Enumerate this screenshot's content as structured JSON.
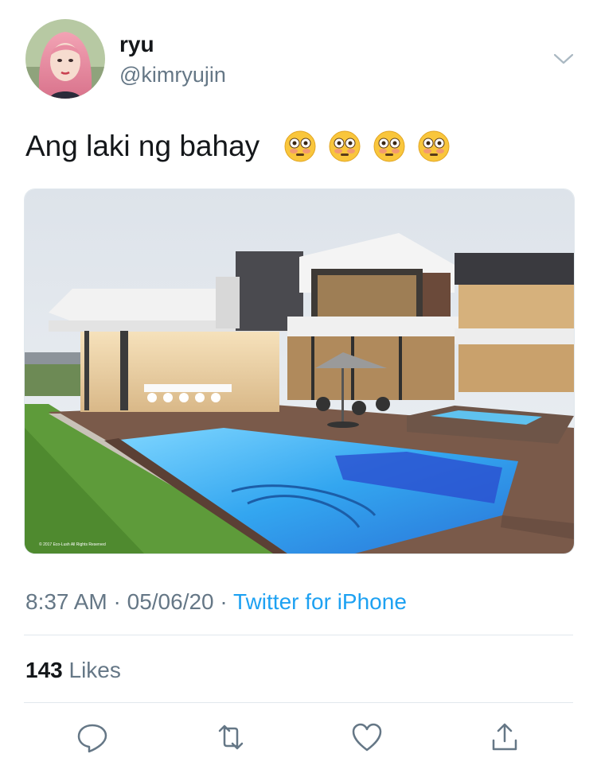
{
  "user": {
    "name": "ryu",
    "handle": "@kimryujin"
  },
  "tweet": {
    "text": "Ang laki ng bahay",
    "emoji": [
      "😳",
      "😳",
      "😳",
      "😳"
    ]
  },
  "photo": {
    "icon": "house-photo",
    "watermark": "© 2017 Eco-Lush All Rights Reserved"
  },
  "meta": {
    "time": "8:37 AM",
    "date": "05/06/20",
    "source": "Twitter for iPhone",
    "separator": " · "
  },
  "stats": {
    "likes_count": "143",
    "likes_label": "Likes"
  },
  "actions": {
    "reply": "reply-icon",
    "retweet": "retweet-icon",
    "like": "heart-icon",
    "share": "share-icon"
  },
  "colors": {
    "link": "#1da1f2",
    "muted": "#657786",
    "text": "#14171a",
    "divider": "#e1e8ed"
  }
}
